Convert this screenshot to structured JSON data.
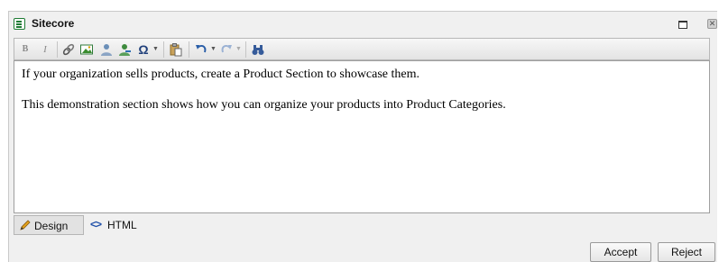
{
  "window": {
    "title": "Sitecore",
    "close_glyph": "✕"
  },
  "toolbar": {
    "bold": "B",
    "italic": "I",
    "special_char": "Ω",
    "dropdown_caret": "▼"
  },
  "editor": {
    "paragraphs": [
      "If your organization sells products, create a Product Section to showcase them.",
      "This demonstration section shows how you can organize your products into Product Categories."
    ]
  },
  "modes": {
    "design": "Design",
    "html": "HTML",
    "html_glyph": "<>"
  },
  "actions": {
    "accept": "Accept",
    "reject": "Reject"
  },
  "colors": {
    "accent_green": "#1e7b34",
    "link_blue": "#1f4fa8"
  },
  "icons": [
    "document-icon",
    "bold-icon",
    "italic-icon",
    "link-icon",
    "image-icon",
    "user-icon",
    "user-remove-icon",
    "omega-icon",
    "paste-icon",
    "undo-icon",
    "redo-icon",
    "find-icon",
    "pencil-icon",
    "code-icon"
  ]
}
